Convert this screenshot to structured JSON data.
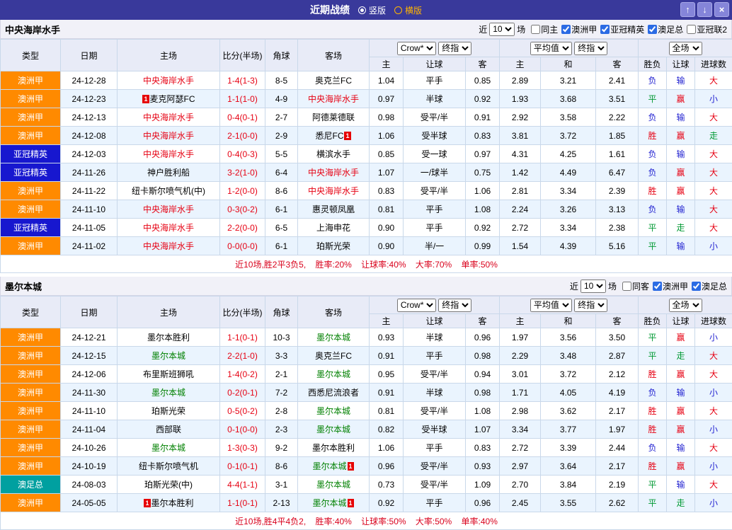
{
  "topbar": {
    "title": "近期战绩",
    "vertical_label": "竖版",
    "horizontal_label": "横版",
    "up_icon": "↑",
    "down_icon": "↓",
    "close_icon": "×"
  },
  "colors": {
    "league_aus": "#ff8a00",
    "league_acl": "#1717cf",
    "league_cup": "#00a0a0",
    "win_red": "#e60012",
    "lose_blue": "#1f1fd0",
    "draw_green": "#009933",
    "topbar_bg": "#39399b"
  },
  "filter_labels": {
    "near": "近",
    "count": "10",
    "games": "场"
  },
  "columns": {
    "type": "类型",
    "date": "日期",
    "home": "主场",
    "score": "比分(半场)",
    "corner": "角球",
    "away": "客场",
    "h": "主",
    "line": "让球",
    "a": "客",
    "h2": "主",
    "d": "和",
    "a2": "客",
    "wl": "胜负",
    "let": "让球",
    "goals": "进球数"
  },
  "selects": {
    "odds_source": "Crow*",
    "odds_time": "终指",
    "avg_source": "平均值",
    "avg_time": "终指",
    "scope": "全场"
  },
  "sections": [
    {
      "team": "中央海岸水手",
      "filters": [
        {
          "label": "同主",
          "checked": false
        },
        {
          "label": "澳洲甲",
          "checked": true
        },
        {
          "label": "亚冠精英",
          "checked": true
        },
        {
          "label": "澳足总",
          "checked": true
        },
        {
          "label": "亚冠联2",
          "checked": false
        }
      ],
      "rows": [
        {
          "lg": "aus",
          "lea": "澳洲甲",
          "d": "24-12-28",
          "h": {
            "n": "中央海岸水手",
            "c": "red"
          },
          "s": "1-4(1-3)",
          "cn": "8-5",
          "a": {
            "n": "奥克兰FC",
            "c": "black"
          },
          "o1": [
            "1.04",
            "平手",
            "0.85"
          ],
          "o2": [
            "2.89",
            "3.21",
            "2.41"
          ],
          "r": [
            [
              "负",
              "blue"
            ],
            [
              "输",
              "blue"
            ],
            [
              "大",
              "red"
            ]
          ]
        },
        {
          "lg": "aus",
          "lea": "澳洲甲",
          "d": "24-12-23",
          "h": {
            "n": "麦克阿瑟FC",
            "c": "black",
            "b": "pre"
          },
          "s": "1-1(1-0)",
          "cn": "4-9",
          "a": {
            "n": "中央海岸水手",
            "c": "red"
          },
          "o1": [
            "0.97",
            "半球",
            "0.92"
          ],
          "o2": [
            "1.93",
            "3.68",
            "3.51"
          ],
          "r": [
            [
              "平",
              "green"
            ],
            [
              "赢",
              "red"
            ],
            [
              "小",
              "blue"
            ]
          ]
        },
        {
          "lg": "aus",
          "lea": "澳洲甲",
          "d": "24-12-13",
          "h": {
            "n": "中央海岸水手",
            "c": "red"
          },
          "s": "0-4(0-1)",
          "cn": "2-7",
          "a": {
            "n": "阿德莱德联",
            "c": "black"
          },
          "o1": [
            "0.98",
            "受平/半",
            "0.91"
          ],
          "o2": [
            "2.92",
            "3.58",
            "2.22"
          ],
          "r": [
            [
              "负",
              "blue"
            ],
            [
              "输",
              "blue"
            ],
            [
              "大",
              "red"
            ]
          ]
        },
        {
          "lg": "aus",
          "lea": "澳洲甲",
          "d": "24-12-08",
          "h": {
            "n": "中央海岸水手",
            "c": "red"
          },
          "s": "2-1(0-0)",
          "cn": "2-9",
          "a": {
            "n": "悉尼FC",
            "c": "black",
            "b": "post"
          },
          "o1": [
            "1.06",
            "受半球",
            "0.83"
          ],
          "o2": [
            "3.81",
            "3.72",
            "1.85"
          ],
          "r": [
            [
              "胜",
              "red"
            ],
            [
              "赢",
              "red"
            ],
            [
              "走",
              "green"
            ]
          ]
        },
        {
          "lg": "acl",
          "lea": "亚冠精英",
          "d": "24-12-03",
          "h": {
            "n": "中央海岸水手",
            "c": "red"
          },
          "s": "0-4(0-3)",
          "cn": "5-5",
          "a": {
            "n": "横滨水手",
            "c": "black"
          },
          "o1": [
            "0.85",
            "受一球",
            "0.97"
          ],
          "o2": [
            "4.31",
            "4.25",
            "1.61"
          ],
          "r": [
            [
              "负",
              "blue"
            ],
            [
              "输",
              "blue"
            ],
            [
              "大",
              "red"
            ]
          ]
        },
        {
          "lg": "acl",
          "lea": "亚冠精英",
          "d": "24-11-26",
          "h": {
            "n": "神户胜利船",
            "c": "black"
          },
          "s": "3-2(1-0)",
          "cn": "6-4",
          "a": {
            "n": "中央海岸水手",
            "c": "red"
          },
          "o1": [
            "1.07",
            "一/球半",
            "0.75"
          ],
          "o2": [
            "1.42",
            "4.49",
            "6.47"
          ],
          "r": [
            [
              "负",
              "blue"
            ],
            [
              "赢",
              "red"
            ],
            [
              "大",
              "red"
            ]
          ]
        },
        {
          "lg": "aus",
          "lea": "澳洲甲",
          "d": "24-11-22",
          "h": {
            "n": "纽卡斯尔喷气机(中)",
            "c": "black"
          },
          "s": "1-2(0-0)",
          "cn": "8-6",
          "a": {
            "n": "中央海岸水手",
            "c": "red"
          },
          "o1": [
            "0.83",
            "受平/半",
            "1.06"
          ],
          "o2": [
            "2.81",
            "3.34",
            "2.39"
          ],
          "r": [
            [
              "胜",
              "red"
            ],
            [
              "赢",
              "red"
            ],
            [
              "大",
              "red"
            ]
          ]
        },
        {
          "lg": "aus",
          "lea": "澳洲甲",
          "d": "24-11-10",
          "h": {
            "n": "中央海岸水手",
            "c": "red"
          },
          "s": "0-3(0-2)",
          "cn": "6-1",
          "a": {
            "n": "惠灵顿凤凰",
            "c": "black"
          },
          "o1": [
            "0.81",
            "平手",
            "1.08"
          ],
          "o2": [
            "2.24",
            "3.26",
            "3.13"
          ],
          "r": [
            [
              "负",
              "blue"
            ],
            [
              "输",
              "blue"
            ],
            [
              "大",
              "red"
            ]
          ]
        },
        {
          "lg": "acl",
          "lea": "亚冠精英",
          "d": "24-11-05",
          "h": {
            "n": "中央海岸水手",
            "c": "red"
          },
          "s": "2-2(0-0)",
          "cn": "6-5",
          "a": {
            "n": "上海申花",
            "c": "black"
          },
          "o1": [
            "0.90",
            "平手",
            "0.92"
          ],
          "o2": [
            "2.72",
            "3.34",
            "2.38"
          ],
          "r": [
            [
              "平",
              "green"
            ],
            [
              "走",
              "green"
            ],
            [
              "大",
              "red"
            ]
          ]
        },
        {
          "lg": "aus",
          "lea": "澳洲甲",
          "d": "24-11-02",
          "h": {
            "n": "中央海岸水手",
            "c": "red"
          },
          "s": "0-0(0-0)",
          "cn": "6-1",
          "a": {
            "n": "珀斯光荣",
            "c": "black"
          },
          "o1": [
            "0.90",
            "半/一",
            "0.99"
          ],
          "o2": [
            "1.54",
            "4.39",
            "5.16"
          ],
          "r": [
            [
              "平",
              "green"
            ],
            [
              "输",
              "blue"
            ],
            [
              "小",
              "blue"
            ]
          ]
        }
      ],
      "summary": "近10场,胜2平3负5, 胜率:20% 让球率:40% 大率:70% 单率:50%"
    },
    {
      "team": "墨尔本城",
      "filters": [
        {
          "label": "同客",
          "checked": false
        },
        {
          "label": "澳洲甲",
          "checked": true
        },
        {
          "label": "澳足总",
          "checked": true
        }
      ],
      "rows": [
        {
          "lg": "aus",
          "lea": "澳洲甲",
          "d": "24-12-21",
          "h": {
            "n": "墨尔本胜利",
            "c": "black"
          },
          "s": "1-1(0-1)",
          "cn": "10-3",
          "a": {
            "n": "墨尔本城",
            "c": "tgreen"
          },
          "o1": [
            "0.93",
            "半球",
            "0.96"
          ],
          "o2": [
            "1.97",
            "3.56",
            "3.50"
          ],
          "r": [
            [
              "平",
              "green"
            ],
            [
              "赢",
              "red"
            ],
            [
              "小",
              "blue"
            ]
          ]
        },
        {
          "lg": "aus",
          "lea": "澳洲甲",
          "d": "24-12-15",
          "h": {
            "n": "墨尔本城",
            "c": "tgreen"
          },
          "s": "2-2(1-0)",
          "cn": "3-3",
          "a": {
            "n": "奥克兰FC",
            "c": "black"
          },
          "o1": [
            "0.91",
            "平手",
            "0.98"
          ],
          "o2": [
            "2.29",
            "3.48",
            "2.87"
          ],
          "r": [
            [
              "平",
              "green"
            ],
            [
              "走",
              "green"
            ],
            [
              "大",
              "red"
            ]
          ]
        },
        {
          "lg": "aus",
          "lea": "澳洲甲",
          "d": "24-12-06",
          "h": {
            "n": "布里斯班狮吼",
            "c": "black"
          },
          "s": "1-4(0-2)",
          "cn": "2-1",
          "a": {
            "n": "墨尔本城",
            "c": "tgreen"
          },
          "o1": [
            "0.95",
            "受平/半",
            "0.94"
          ],
          "o2": [
            "3.01",
            "3.72",
            "2.12"
          ],
          "r": [
            [
              "胜",
              "red"
            ],
            [
              "赢",
              "red"
            ],
            [
              "大",
              "red"
            ]
          ]
        },
        {
          "lg": "aus",
          "lea": "澳洲甲",
          "d": "24-11-30",
          "h": {
            "n": "墨尔本城",
            "c": "tgreen"
          },
          "s": "0-2(0-1)",
          "cn": "7-2",
          "a": {
            "n": "西悉尼流浪者",
            "c": "black"
          },
          "o1": [
            "0.91",
            "半球",
            "0.98"
          ],
          "o2": [
            "1.71",
            "4.05",
            "4.19"
          ],
          "r": [
            [
              "负",
              "blue"
            ],
            [
              "输",
              "blue"
            ],
            [
              "小",
              "blue"
            ]
          ]
        },
        {
          "lg": "aus",
          "lea": "澳洲甲",
          "d": "24-11-10",
          "h": {
            "n": "珀斯光荣",
            "c": "black"
          },
          "s": "0-5(0-2)",
          "cn": "2-8",
          "a": {
            "n": "墨尔本城",
            "c": "tgreen"
          },
          "o1": [
            "0.81",
            "受平/半",
            "1.08"
          ],
          "o2": [
            "2.98",
            "3.62",
            "2.17"
          ],
          "r": [
            [
              "胜",
              "red"
            ],
            [
              "赢",
              "red"
            ],
            [
              "大",
              "red"
            ]
          ]
        },
        {
          "lg": "aus",
          "lea": "澳洲甲",
          "d": "24-11-04",
          "h": {
            "n": "西部联",
            "c": "black"
          },
          "s": "0-1(0-0)",
          "cn": "2-3",
          "a": {
            "n": "墨尔本城",
            "c": "tgreen"
          },
          "o1": [
            "0.82",
            "受半球",
            "1.07"
          ],
          "o2": [
            "3.34",
            "3.77",
            "1.97"
          ],
          "r": [
            [
              "胜",
              "red"
            ],
            [
              "赢",
              "red"
            ],
            [
              "小",
              "blue"
            ]
          ]
        },
        {
          "lg": "aus",
          "lea": "澳洲甲",
          "d": "24-10-26",
          "h": {
            "n": "墨尔本城",
            "c": "tgreen"
          },
          "s": "1-3(0-3)",
          "cn": "9-2",
          "a": {
            "n": "墨尔本胜利",
            "c": "black"
          },
          "o1": [
            "1.06",
            "平手",
            "0.83"
          ],
          "o2": [
            "2.72",
            "3.39",
            "2.44"
          ],
          "r": [
            [
              "负",
              "blue"
            ],
            [
              "输",
              "blue"
            ],
            [
              "大",
              "red"
            ]
          ]
        },
        {
          "lg": "aus",
          "lea": "澳洲甲",
          "d": "24-10-19",
          "h": {
            "n": "纽卡斯尔喷气机",
            "c": "black"
          },
          "s": "0-1(0-1)",
          "cn": "8-6",
          "a": {
            "n": "墨尔本城",
            "c": "tgreen",
            "b": "post"
          },
          "o1": [
            "0.96",
            "受平/半",
            "0.93"
          ],
          "o2": [
            "2.97",
            "3.64",
            "2.17"
          ],
          "r": [
            [
              "胜",
              "red"
            ],
            [
              "赢",
              "red"
            ],
            [
              "小",
              "blue"
            ]
          ]
        },
        {
          "lg": "cup",
          "lea": "澳足总",
          "d": "24-08-03",
          "h": {
            "n": "珀斯光荣(中)",
            "c": "black"
          },
          "s": "4-4(1-1)",
          "cn": "3-1",
          "a": {
            "n": "墨尔本城",
            "c": "tgreen"
          },
          "o1": [
            "0.73",
            "受平/半",
            "1.09"
          ],
          "o2": [
            "2.70",
            "3.84",
            "2.19"
          ],
          "r": [
            [
              "平",
              "green"
            ],
            [
              "输",
              "blue"
            ],
            [
              "大",
              "red"
            ]
          ]
        },
        {
          "lg": "aus",
          "lea": "澳洲甲",
          "d": "24-05-05",
          "h": {
            "n": "墨尔本胜利",
            "c": "black",
            "b": "pre"
          },
          "s": "1-1(0-1)",
          "cn": "2-13",
          "a": {
            "n": "墨尔本城",
            "c": "tgreen",
            "b": "post"
          },
          "o1": [
            "0.92",
            "平手",
            "0.96"
          ],
          "o2": [
            "2.45",
            "3.55",
            "2.62"
          ],
          "r": [
            [
              "平",
              "green"
            ],
            [
              "走",
              "green"
            ],
            [
              "小",
              "blue"
            ]
          ]
        }
      ],
      "summary": "近10场,胜4平4负2, 胜率:40% 让球率:50% 大率:50% 单率:40%"
    }
  ]
}
